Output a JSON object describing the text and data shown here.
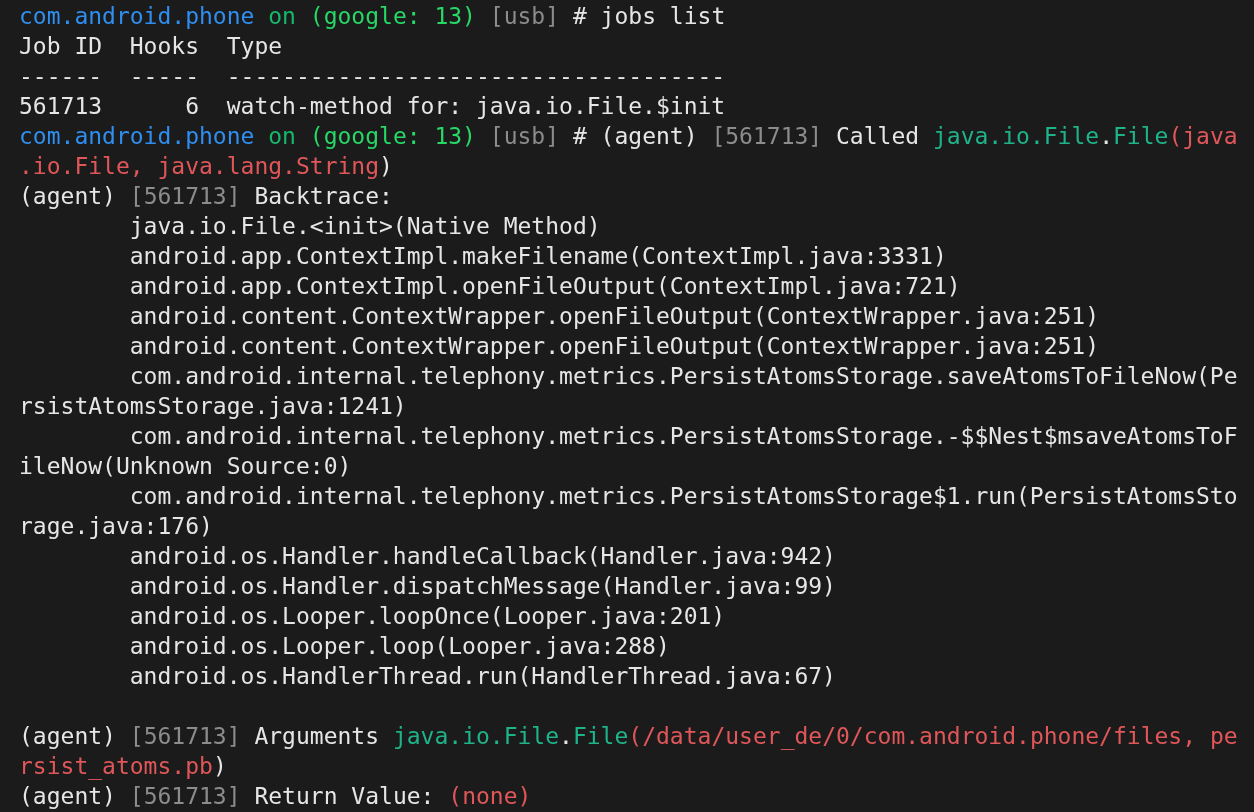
{
  "terminal": {
    "lines": [
      {
        "kind": "output",
        "indent": false,
        "segments": [
          {
            "kind": "device",
            "text": "com.android.phone "
          },
          {
            "kind": "keyword",
            "text": "on "
          },
          {
            "kind": "context",
            "text": "(google: 13) "
          },
          {
            "kind": "muted",
            "text": "[usb]"
          },
          {
            "kind": "text",
            "text": " # jobs list"
          }
        ]
      },
      {
        "kind": "output",
        "indent": false,
        "segments": [
          {
            "kind": "text",
            "text": "Job ID  Hooks  Type"
          }
        ]
      },
      {
        "kind": "output",
        "indent": false,
        "segments": [
          {
            "kind": "text",
            "text": "------  -----  ------------------------------------"
          }
        ]
      },
      {
        "kind": "output",
        "indent": false,
        "segments": [
          {
            "kind": "text",
            "text": "561713      6  watch-method for: java.io.File.$init"
          }
        ]
      },
      {
        "kind": "output",
        "indent": false,
        "segments": [
          {
            "kind": "device",
            "text": "com.android.phone "
          },
          {
            "kind": "keyword",
            "text": "on "
          },
          {
            "kind": "context",
            "text": "(google: 13) "
          },
          {
            "kind": "muted",
            "text": "[usb]"
          },
          {
            "kind": "text",
            "text": " # (agent) "
          },
          {
            "kind": "muted",
            "text": "[561713]"
          },
          {
            "kind": "text",
            "text": " Called "
          },
          {
            "kind": "method",
            "text": "java.io.File"
          },
          {
            "kind": "text",
            "text": "."
          },
          {
            "kind": "method",
            "text": "File"
          },
          {
            "kind": "argument",
            "text": "(java"
          }
        ]
      },
      {
        "kind": "output",
        "indent": false,
        "segments": [
          {
            "kind": "argument",
            "text": ".io.File, java.lang.String"
          },
          {
            "kind": "text",
            "text": ")"
          }
        ]
      },
      {
        "kind": "output",
        "indent": false,
        "segments": [
          {
            "kind": "text",
            "text": "(agent) "
          },
          {
            "kind": "muted",
            "text": "[561713]"
          },
          {
            "kind": "text",
            "text": " Backtrace:"
          }
        ]
      },
      {
        "kind": "output",
        "indent": true,
        "segments": [
          {
            "kind": "text",
            "text": "java.io.File.<init>(Native Method)"
          }
        ]
      },
      {
        "kind": "output",
        "indent": true,
        "segments": [
          {
            "kind": "text",
            "text": "android.app.ContextImpl.makeFilename(ContextImpl.java:3331)"
          }
        ]
      },
      {
        "kind": "output",
        "indent": true,
        "segments": [
          {
            "kind": "text",
            "text": "android.app.ContextImpl.openFileOutput(ContextImpl.java:721)"
          }
        ]
      },
      {
        "kind": "output",
        "indent": true,
        "segments": [
          {
            "kind": "text",
            "text": "android.content.ContextWrapper.openFileOutput(ContextWrapper.java:251)"
          }
        ]
      },
      {
        "kind": "output",
        "indent": true,
        "segments": [
          {
            "kind": "text",
            "text": "android.content.ContextWrapper.openFileOutput(ContextWrapper.java:251)"
          }
        ]
      },
      {
        "kind": "output",
        "indent": true,
        "segments": [
          {
            "kind": "text",
            "text": "com.android.internal.telephony.metrics.PersistAtomsStorage.saveAtomsToFileNow(Pe"
          }
        ]
      },
      {
        "kind": "output",
        "indent": false,
        "segments": [
          {
            "kind": "text",
            "text": "rsistAtomsStorage.java:1241)"
          }
        ]
      },
      {
        "kind": "output",
        "indent": true,
        "segments": [
          {
            "kind": "text",
            "text": "com.android.internal.telephony.metrics.PersistAtomsStorage.-$$Nest$msaveAtomsToF"
          }
        ]
      },
      {
        "kind": "output",
        "indent": false,
        "segments": [
          {
            "kind": "text",
            "text": "ileNow(Unknown Source:0)"
          }
        ]
      },
      {
        "kind": "output",
        "indent": true,
        "segments": [
          {
            "kind": "text",
            "text": "com.android.internal.telephony.metrics.PersistAtomsStorage$1.run(PersistAtomsSto"
          }
        ]
      },
      {
        "kind": "output",
        "indent": false,
        "segments": [
          {
            "kind": "text",
            "text": "rage.java:176)"
          }
        ]
      },
      {
        "kind": "output",
        "indent": true,
        "segments": [
          {
            "kind": "text",
            "text": "android.os.Handler.handleCallback(Handler.java:942)"
          }
        ]
      },
      {
        "kind": "output",
        "indent": true,
        "segments": [
          {
            "kind": "text",
            "text": "android.os.Handler.dispatchMessage(Handler.java:99)"
          }
        ]
      },
      {
        "kind": "output",
        "indent": true,
        "segments": [
          {
            "kind": "text",
            "text": "android.os.Looper.loopOnce(Looper.java:201)"
          }
        ]
      },
      {
        "kind": "output",
        "indent": true,
        "segments": [
          {
            "kind": "text",
            "text": "android.os.Looper.loop(Looper.java:288)"
          }
        ]
      },
      {
        "kind": "output",
        "indent": true,
        "segments": [
          {
            "kind": "text",
            "text": "android.os.HandlerThread.run(HandlerThread.java:67)"
          }
        ]
      },
      {
        "kind": "blank"
      },
      {
        "kind": "output",
        "indent": false,
        "segments": [
          {
            "kind": "text",
            "text": "(agent) "
          },
          {
            "kind": "muted",
            "text": "[561713]"
          },
          {
            "kind": "text",
            "text": " Arguments "
          },
          {
            "kind": "method",
            "text": "java.io.File"
          },
          {
            "kind": "text",
            "text": "."
          },
          {
            "kind": "method",
            "text": "File"
          },
          {
            "kind": "argument",
            "text": "(/data/user_de/0/com.android.phone/files, pe"
          }
        ]
      },
      {
        "kind": "output",
        "indent": false,
        "segments": [
          {
            "kind": "argument",
            "text": "rsist_atoms.pb"
          },
          {
            "kind": "text",
            "text": ")"
          }
        ]
      },
      {
        "kind": "output",
        "indent": false,
        "segments": [
          {
            "kind": "text",
            "text": "(agent) "
          },
          {
            "kind": "muted",
            "text": "[561713]"
          },
          {
            "kind": "text",
            "text": " Return Value: "
          },
          {
            "kind": "argument",
            "text": "(none)"
          }
        ]
      }
    ]
  }
}
